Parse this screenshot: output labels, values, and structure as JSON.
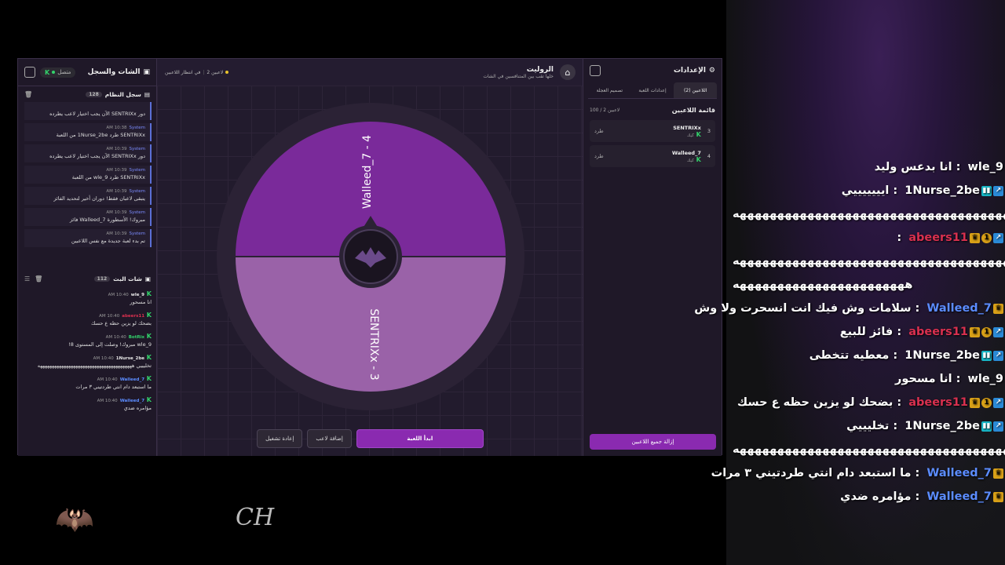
{
  "colors": {
    "accent": "#8a2ab0",
    "wheel_dark": "#7a2a9a",
    "wheel_light": "#9a62a8",
    "green": "#33d36b",
    "yellow": "#e8c22c"
  },
  "left_panel": {
    "title": "الشات والسجل",
    "connection": "متصل",
    "system_log": {
      "title": "سجل النظام",
      "count": "128",
      "items": [
        {
          "time": "",
          "source": "",
          "text": "دور SENTRIXx الآن يجب اختيار لاعب يطرده"
        },
        {
          "time": "AM 10:38",
          "source": "System",
          "text": "SENTRIXx طرد 1Nurse_2be من اللعبة"
        },
        {
          "time": "AM 10:39",
          "source": "System",
          "text": "دور SENTRIXx الآن يجب اختيار لاعب يطرده"
        },
        {
          "time": "AM 10:39",
          "source": "System",
          "text": "SENTRIXx طرد wle_9 من اللعبة"
        },
        {
          "time": "AM 10:39",
          "source": "System",
          "text": "يتبقى لاعبان فقط! دوران أخير لتحديد الفائز"
        },
        {
          "time": "AM 10:39",
          "source": "System",
          "text": "مبروك! الأسطورة Walleed_7 فائز"
        },
        {
          "time": "AM 10:39",
          "source": "System",
          "text": "تم بدء لعبة جديدة مع نفس اللاعبين"
        }
      ]
    },
    "live_chat": {
      "title": "شات البث",
      "count": "112",
      "items": [
        {
          "time": "AM 10:40",
          "user": "wle_9",
          "color": "#e6e6e6",
          "text": "انا مسحور"
        },
        {
          "time": "AM 10:40",
          "user": "abeers11",
          "color": "#d9304f",
          "text": "بضحك لو يزين حظه ع حسك"
        },
        {
          "time": "AM 10:40",
          "user": "BotRix",
          "color": "#33d36b",
          "text": "wle_9 مبروك! وصلت إلى المستوى 8!"
        },
        {
          "time": "AM 10:40",
          "user": "1Nurse_2be",
          "color": "#e6e6e6",
          "text": "تخليييي ههههههههههههههههههههههههههههههههههههههههه"
        },
        {
          "time": "AM 10:40",
          "user": "Walleed_7",
          "color": "#5b8cff",
          "text": "ما استبعد دام انتي طردتيني ٣ مرات"
        },
        {
          "time": "AM 10:40",
          "user": "Walleed_7",
          "color": "#5b8cff",
          "text": "مؤامره ضدي"
        }
      ]
    }
  },
  "center": {
    "title": "الروليت",
    "subtitle": "خلها تقب بين المتنافسين في الشات",
    "players_status": "2 لاعبين",
    "waiting": "في انتظار اللاعبين",
    "wheel": {
      "segments": [
        {
          "label": "Walleed_7 - 4"
        },
        {
          "label": "SENTRIXx - 3"
        }
      ]
    },
    "buttons": {
      "start": "ابدأ اللعبة",
      "add_player": "إضافة لاعب",
      "restart": "إعادة تشغيل"
    }
  },
  "right_panel": {
    "title": "الإعدادات",
    "tabs": [
      "اللاعبين (2)",
      "إعدادات اللعبة",
      "تصميم العجلة"
    ],
    "players_title": "قائمة اللاعبين",
    "players_count": "100 / 2 لاعبين",
    "players": [
      {
        "num": "3",
        "name": "SENTRIXx",
        "status": "كيك",
        "kick": "طرد"
      },
      {
        "num": "4",
        "name": "Walleed_7",
        "status": "كيك",
        "kick": "طرد"
      }
    ],
    "remove_all": "إزالة جميع اللاعبين"
  },
  "overlay_chat": [
    {
      "user": "wle_9",
      "color": "#ffffff",
      "badges": [],
      "text": "انا بدعس وليد"
    },
    {
      "user": "1Nurse_2be",
      "color": "#ffffff",
      "badges": [
        "prime",
        "switch"
      ],
      "text": "ايييييييي"
    },
    {
      "overflow": true,
      "text": "هههههههههههههههههههههههههههههههههههههههه"
    },
    {
      "user": "abeers11",
      "color": "#d9304f",
      "badges": [
        "prime",
        "one",
        "crown"
      ],
      "text": ""
    },
    {
      "overflow": true,
      "text": "هههههههههههههههههههههههههههههههههههههههههه"
    },
    {
      "overflow": true,
      "text": "هههههههههههههههههههههههه"
    },
    {
      "user": "Walleed_7",
      "color": "#5b8cff",
      "badges": [
        "crown"
      ],
      "text": "سلامات وش فيك انت انسحرت ولا وش"
    },
    {
      "user": "abeers11",
      "color": "#d9304f",
      "badges": [
        "prime",
        "one",
        "crown"
      ],
      "text": "فائز للبيع"
    },
    {
      "user": "1Nurse_2be",
      "color": "#ffffff",
      "badges": [
        "prime",
        "switch"
      ],
      "text": "معطيه تتخطى"
    },
    {
      "user": "wle_9",
      "color": "#ffffff",
      "badges": [],
      "text": "انا مسحور"
    },
    {
      "user": "abeers11",
      "color": "#d9304f",
      "badges": [
        "prime",
        "one",
        "crown"
      ],
      "text": "بضحك لو يزين حظه ع حسك"
    },
    {
      "user": "1Nurse_2be",
      "color": "#ffffff",
      "badges": [
        "prime",
        "switch"
      ],
      "text": "تخليييي"
    },
    {
      "overflow": true,
      "text": "هههههههههههههههههههههههههههههههههههههههه"
    },
    {
      "user": "Walleed_7",
      "color": "#5b8cff",
      "badges": [
        "crown"
      ],
      "text": "ما استبعد دام انتي طردتيني ٣ مرات"
    },
    {
      "user": "Walleed_7",
      "color": "#5b8cff",
      "badges": [
        "crown"
      ],
      "text": "مؤامره ضدي"
    }
  ]
}
